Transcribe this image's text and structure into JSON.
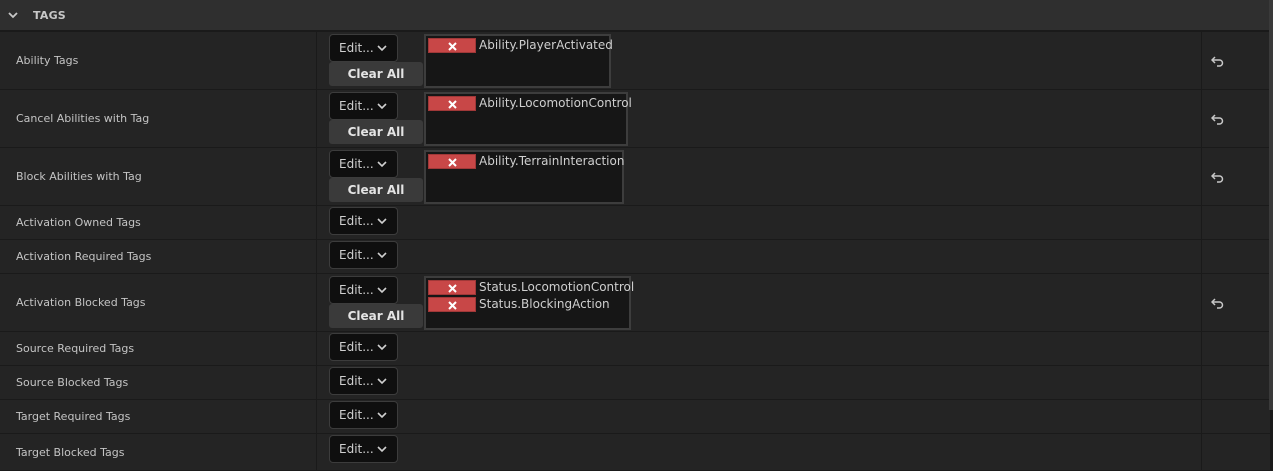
{
  "section": {
    "title": "TAGS"
  },
  "edit_label": "Edit...",
  "clear_label": "Clear All",
  "rows": [
    {
      "label": "Ability Tags",
      "tags": [
        "Ability.PlayerActivated"
      ]
    },
    {
      "label": "Cancel Abilities with Tag",
      "tags": [
        "Ability.LocomotionControl"
      ]
    },
    {
      "label": "Block Abilities with Tag",
      "tags": [
        "Ability.TerrainInteraction"
      ]
    },
    {
      "label": "Activation Owned Tags",
      "tags": []
    },
    {
      "label": "Activation Required Tags",
      "tags": []
    },
    {
      "label": "Activation Blocked Tags",
      "tags": [
        "Status.LocomotionControl",
        "Status.BlockingAction"
      ]
    },
    {
      "label": "Source Required Tags",
      "tags": []
    },
    {
      "label": "Source Blocked Tags",
      "tags": []
    },
    {
      "label": "Target Required Tags",
      "tags": []
    },
    {
      "label": "Target Blocked Tags",
      "tags": []
    }
  ],
  "icons": {
    "collapse": "chevron-down-icon",
    "dropdown": "chevron-down-icon",
    "remove_tag": "close-icon",
    "reset": "reset-arrow-icon"
  },
  "colors": {
    "background": "#1a1a1a",
    "row": "#242424",
    "header": "#2f2f2f",
    "tag_remove": "#c84747"
  }
}
